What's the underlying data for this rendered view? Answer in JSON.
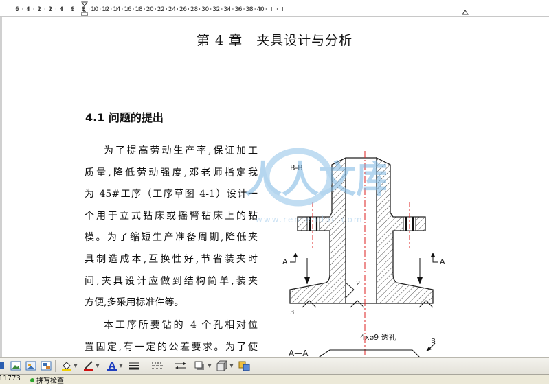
{
  "ruler": {
    "labels": [
      "6",
      "4",
      "2",
      "2",
      "4",
      "6",
      "8",
      "10",
      "12",
      "14",
      "16",
      "18",
      "20",
      "22",
      "24",
      "26",
      "28",
      "30",
      "32",
      "34",
      "36",
      "38",
      "40"
    ]
  },
  "document": {
    "chapter_title": "第 4 章　夹具设计与分析",
    "section_heading": "4.1  问题的提出",
    "paragraph1_lines": [
      "为了提高劳动生产率,保证加工",
      "质量,降低劳动强度,邓老师指定我",
      "为 45#工序（工序草图 4-1）设计一",
      "个用于立式钻床或摇臂钻床上的钻",
      "模。为了缩短生产准备周期,降低夹",
      "具制造成本,互换性好,节省装夹时",
      "间,夹具设计应做到结构简单,装夹",
      "方便,多采用标准件等。"
    ],
    "paragraph2_lines": [
      "本工序所要钻的 4 个孔相对位",
      "置固定,有一定的公差要求。为了使"
    ]
  },
  "drawing": {
    "section_bb": "B-B",
    "label_a_left": "A",
    "label_a_right": "A",
    "label_2": "2",
    "label_3": "3",
    "hole_note": "4x⌀9 透孔",
    "label_b": "B",
    "section_aa": "A—A"
  },
  "watermark": {
    "brand": "人人文库",
    "url": "www.renrendoc.com"
  },
  "toolbar": {
    "icons": [
      "draw-icon",
      "insert-picture-icon",
      "insert-image-icon",
      "insert-wordart-icon",
      "insert-diagram-icon",
      "fill-color-icon",
      "line-color-icon",
      "font-color-icon",
      "line-style-icon",
      "dash-style-icon",
      "arrow-style-icon",
      "shadow-icon",
      "3d-icon",
      "arrange-icon"
    ],
    "font_color_glyph": "A",
    "font_color": "#1f3fbf",
    "fill_color": "#f0d000",
    "line_color": "#d01010"
  },
  "statusbar": {
    "left_text": "11773",
    "spell_label": "拼写检查"
  }
}
